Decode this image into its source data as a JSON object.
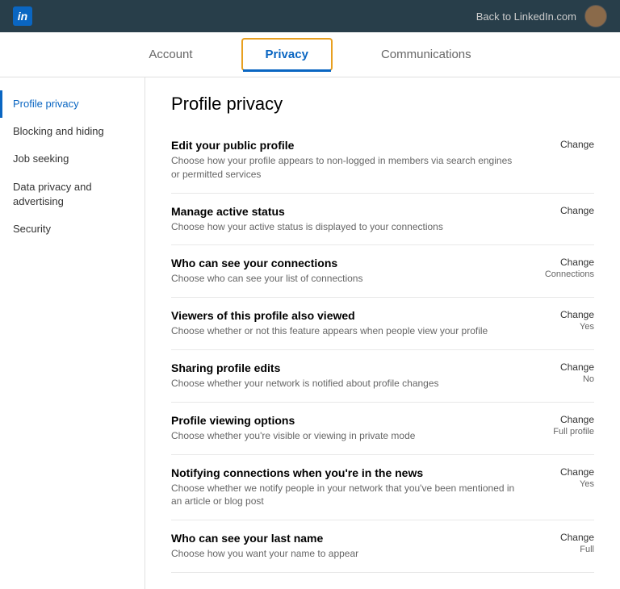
{
  "topbar": {
    "logo_text": "in",
    "back_link": "Back to LinkedIn.com"
  },
  "nav": {
    "tabs": [
      {
        "id": "account",
        "label": "Account",
        "active": false
      },
      {
        "id": "privacy",
        "label": "Privacy",
        "active": true
      },
      {
        "id": "communications",
        "label": "Communications",
        "active": false
      }
    ]
  },
  "sidebar": {
    "items": [
      {
        "id": "profile-privacy",
        "label": "Profile privacy",
        "active": true
      },
      {
        "id": "blocking-hiding",
        "label": "Blocking and hiding",
        "active": false
      },
      {
        "id": "job-seeking",
        "label": "Job seeking",
        "active": false
      },
      {
        "id": "data-privacy",
        "label": "Data privacy and advertising",
        "active": false
      },
      {
        "id": "security",
        "label": "Security",
        "active": false
      }
    ]
  },
  "content": {
    "section_title": "Profile privacy",
    "settings": [
      {
        "id": "edit-public-profile",
        "name": "Edit your public profile",
        "desc": "Choose how your profile appears to non-logged in members via search engines or permitted services",
        "action_label": "Change",
        "value": ""
      },
      {
        "id": "manage-active-status",
        "name": "Manage active status",
        "desc": "Choose how your active status is displayed to your connections",
        "action_label": "Change",
        "value": ""
      },
      {
        "id": "who-see-connections",
        "name": "Who can see your connections",
        "desc": "Choose who can see your list of connections",
        "action_label": "Change",
        "value": "Connections"
      },
      {
        "id": "viewers-also-viewed",
        "name": "Viewers of this profile also viewed",
        "desc": "Choose whether or not this feature appears when people view your profile",
        "action_label": "Change",
        "value": "Yes"
      },
      {
        "id": "sharing-profile-edits",
        "name": "Sharing profile edits",
        "desc": "Choose whether your network is notified about profile changes",
        "action_label": "Change",
        "value": "No"
      },
      {
        "id": "profile-viewing-options",
        "name": "Profile viewing options",
        "desc": "Choose whether you're visible or viewing in private mode",
        "action_label": "Change",
        "value": "Full profile"
      },
      {
        "id": "notifying-connections-news",
        "name": "Notifying connections when you're in the news",
        "desc": "Choose whether we notify people in your network that you've been mentioned in an article or blog post",
        "action_label": "Change",
        "value": "Yes"
      },
      {
        "id": "who-see-last-name",
        "name": "Who can see your last name",
        "desc": "Choose how you want your name to appear",
        "action_label": "Change",
        "value": "Full"
      }
    ]
  }
}
